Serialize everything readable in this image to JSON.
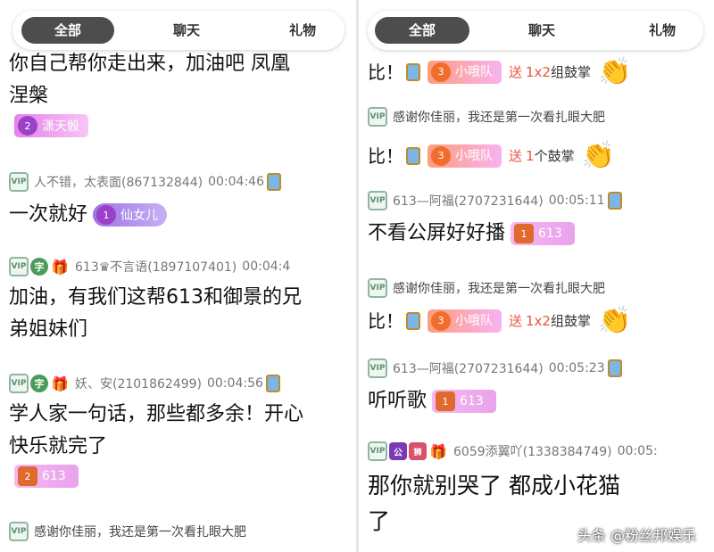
{
  "tabs": [
    "全部",
    "聊天",
    "礼物"
  ],
  "left": {
    "msg1": {
      "text_lines": [
        "你自己帮你走出来，加油吧 凤凰",
        "涅槃"
      ],
      "badge": {
        "level": "2",
        "name": "潇天骰"
      }
    },
    "msg2": {
      "name": "人不错，太表面(867132844)",
      "time": "00:04:46",
      "text": "一次就好",
      "badge": {
        "level": "1",
        "name": "仙女儿"
      }
    },
    "msg3": {
      "ch": "字",
      "name": "613♛不言语(1897107401)",
      "time": "00:04:4",
      "text_lines": [
        "加油，有我们这帮613和御景的兄",
        "弟姐妹们"
      ]
    },
    "msg4": {
      "ch": "字",
      "name": "妖、安(2101862499)",
      "time": "00:04:56",
      "text_lines": [
        "学人家一句话，那些都多余！开心",
        "快乐就完了"
      ],
      "badge": {
        "level": "2",
        "name": "613"
      }
    },
    "msg5": {
      "text": "感谢你佳丽，我还是第一次看扎眼大肥"
    }
  },
  "right": {
    "gift1": {
      "prefix": "比！",
      "level": "3",
      "name": "小哦队",
      "send": "送",
      "qty": "1x2",
      "item": "组鼓掌"
    },
    "msg2": {
      "text": "感谢你佳丽，我还是第一次看扎眼大肥"
    },
    "gift2": {
      "prefix": "比！",
      "level": "3",
      "name": "小哦队",
      "send": "送",
      "qty": "1",
      "item": "个鼓掌"
    },
    "msg3": {
      "name": "613—阿福(2707231644)",
      "time": "00:05:11",
      "text": "不看公屏好好播",
      "badge": {
        "level": "1",
        "name": "613"
      }
    },
    "msg4": {
      "text": "感谢你佳丽，我还是第一次看扎眼大肥"
    },
    "gift3": {
      "prefix": "比！",
      "level": "3",
      "name": "小哦队",
      "send": "送",
      "qty": "1x2",
      "item": "组鼓掌"
    },
    "msg5": {
      "name": "613—阿福(2707231644)",
      "time": "00:05:23",
      "text": "听听歌",
      "badge": {
        "level": "1",
        "name": "613"
      }
    },
    "msg6": {
      "b1": "公",
      "b2": "狮",
      "name": "6059添翼吖(1338384749)",
      "time": "00:05:",
      "text_lines": [
        "那你就别哭了 都成小花猫",
        "了"
      ]
    }
  },
  "watermark": "头条 @粉丝邦娱乐",
  "colors": {
    "active_tab": "#4d4d4d",
    "badge_purple": "#9a41c8",
    "gift_red": "#e8553f"
  }
}
